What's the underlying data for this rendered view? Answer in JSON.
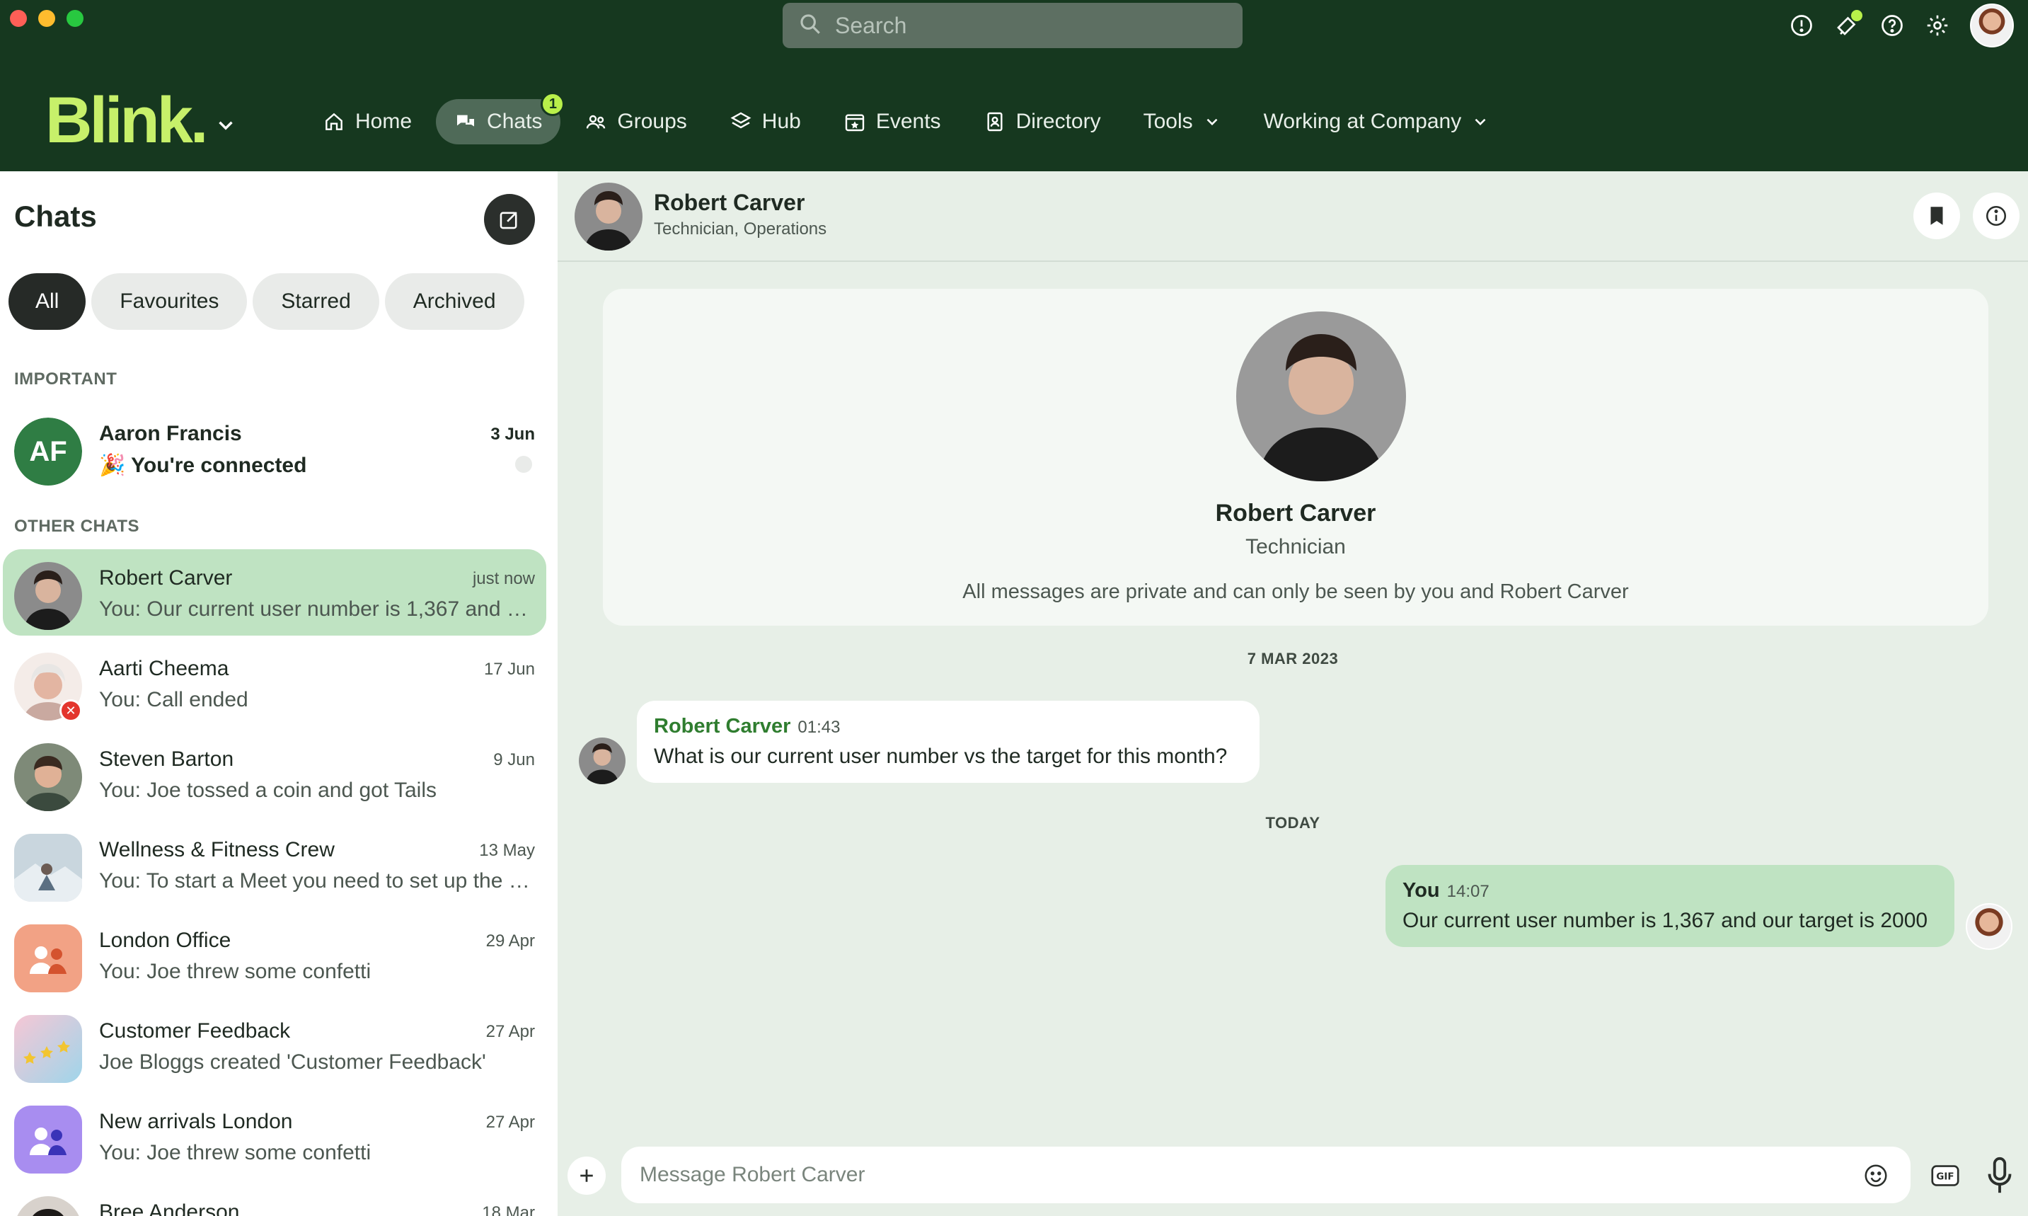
{
  "search": {
    "placeholder": "Search"
  },
  "brand": {
    "logo": "Blink.",
    "accent": "#c7f06a",
    "nav_bg": "#16381f"
  },
  "nav": {
    "items": [
      {
        "label": "Home",
        "icon": "home-icon"
      },
      {
        "label": "Chats",
        "icon": "chat-bubbles-icon",
        "badge": "1",
        "active": true
      },
      {
        "label": "Groups",
        "icon": "groups-icon"
      },
      {
        "label": "Hub",
        "icon": "layers-icon"
      },
      {
        "label": "Events",
        "icon": "calendar-star-icon"
      },
      {
        "label": "Directory",
        "icon": "contact-book-icon"
      },
      {
        "label": "Tools",
        "icon": "chevron-down-icon"
      },
      {
        "label": "Working at Company",
        "icon": "chevron-down-icon"
      }
    ]
  },
  "sidebar": {
    "title": "Chats",
    "filters": [
      "All",
      "Favourites",
      "Starred",
      "Archived"
    ],
    "important_label": "IMPORTANT",
    "other_label": "OTHER CHATS",
    "important": [
      {
        "initials": "AF",
        "name": "Aaron Francis",
        "preview": "🎉 You're connected",
        "time": "3 Jun"
      }
    ],
    "chats": [
      {
        "name": "Robert Carver",
        "preview": "You: Our current user number is 1,367 and our target is 2000",
        "time": "just now"
      },
      {
        "name": "Aarti Cheema",
        "preview": "You: Call ended",
        "time": "17 Jun"
      },
      {
        "name": "Steven Barton",
        "preview": "You: Joe tossed a coin and got Tails",
        "time": "9 Jun"
      },
      {
        "name": "Wellness & Fitness Crew",
        "preview": "You: To start a Meet you need to set up the integration",
        "time": "13 May"
      },
      {
        "name": "London Office",
        "preview": "You: Joe threw some confetti",
        "time": "29 Apr"
      },
      {
        "name": "Customer Feedback",
        "preview": "Joe Bloggs created 'Customer Feedback'",
        "time": "27 Apr"
      },
      {
        "name": "New arrivals London",
        "preview": "You: Joe threw some confetti",
        "time": "27 Apr"
      },
      {
        "name": "Bree Anderson",
        "preview": "",
        "time": "18 Mar"
      }
    ]
  },
  "conversation": {
    "contact_name": "Robert Carver",
    "contact_sub": "Technician, Operations",
    "profile_name": "Robert Carver",
    "profile_role": "Technician",
    "privacy_note": "All messages are private and can only be seen by you and Robert Carver",
    "date_1": "7 MAR 2023",
    "date_2": "TODAY",
    "msg_in": {
      "sender": "Robert Carver",
      "time": "01:43",
      "text": "What is our current user number vs the target for this month?"
    },
    "msg_out": {
      "sender": "You",
      "time": "14:07",
      "text": "Our current user number is 1,367 and our target is 2000"
    },
    "composer_placeholder": "Message Robert Carver"
  }
}
